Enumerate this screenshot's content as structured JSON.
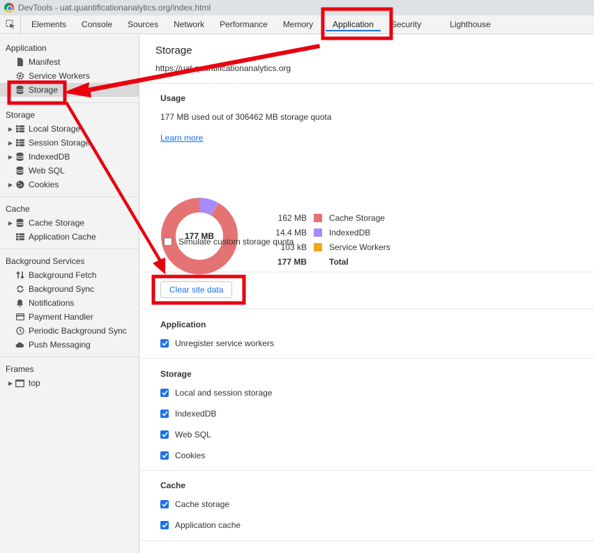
{
  "window": {
    "title": "DevTools - uat.quantificationanalytics.org/index.html"
  },
  "tabs": [
    {
      "label": "Elements"
    },
    {
      "label": "Console"
    },
    {
      "label": "Sources"
    },
    {
      "label": "Network"
    },
    {
      "label": "Performance"
    },
    {
      "label": "Memory"
    },
    {
      "label": "Application"
    },
    {
      "label": "Security"
    },
    {
      "label": "Lighthouse"
    }
  ],
  "sidebar": {
    "application": {
      "heading": "Application",
      "items": [
        "Manifest",
        "Service Workers",
        "Storage"
      ]
    },
    "storage": {
      "heading": "Storage",
      "items": [
        "Local Storage",
        "Session Storage",
        "IndexedDB",
        "Web SQL",
        "Cookies"
      ]
    },
    "cache": {
      "heading": "Cache",
      "items": [
        "Cache Storage",
        "Application Cache"
      ]
    },
    "background": {
      "heading": "Background Services",
      "items": [
        "Background Fetch",
        "Background Sync",
        "Notifications",
        "Payment Handler",
        "Periodic Background Sync",
        "Push Messaging"
      ]
    },
    "frames": {
      "heading": "Frames",
      "items": [
        "top"
      ]
    }
  },
  "main": {
    "title": "Storage",
    "origin": "https://uat.quantificationanalytics.org",
    "usage": {
      "heading": "Usage",
      "summary": "177 MB used out of 306462 MB storage quota",
      "learn_more": "Learn more",
      "donut_center": "177 MB",
      "legend": [
        {
          "value": "162 MB",
          "label": "Cache Storage",
          "color": "#e57373",
          "mb": 162
        },
        {
          "value": "14.4 MB",
          "label": "IndexedDB",
          "color": "#a78bfa",
          "mb": 14.4
        },
        {
          "value": "103 kB",
          "label": "Service Workers",
          "color": "#f4a71d",
          "mb": 0.103
        }
      ],
      "total_value": "177 MB",
      "total_label": "Total",
      "simulate_label": "Simulate custom storage quota",
      "simulate_checked": false
    },
    "clear_button": "Clear site data",
    "application_section": {
      "heading": "Application",
      "options": [
        {
          "label": "Unregister service workers",
          "checked": true
        }
      ]
    },
    "storage_section": {
      "heading": "Storage",
      "options": [
        {
          "label": "Local and session storage",
          "checked": true
        },
        {
          "label": "IndexedDB",
          "checked": true
        },
        {
          "label": "Web SQL",
          "checked": true
        },
        {
          "label": "Cookies",
          "checked": true
        }
      ]
    },
    "cache_section": {
      "heading": "Cache",
      "options": [
        {
          "label": "Cache storage",
          "checked": true
        },
        {
          "label": "Application cache",
          "checked": true
        }
      ]
    }
  },
  "annotation_color": "#e8000f"
}
